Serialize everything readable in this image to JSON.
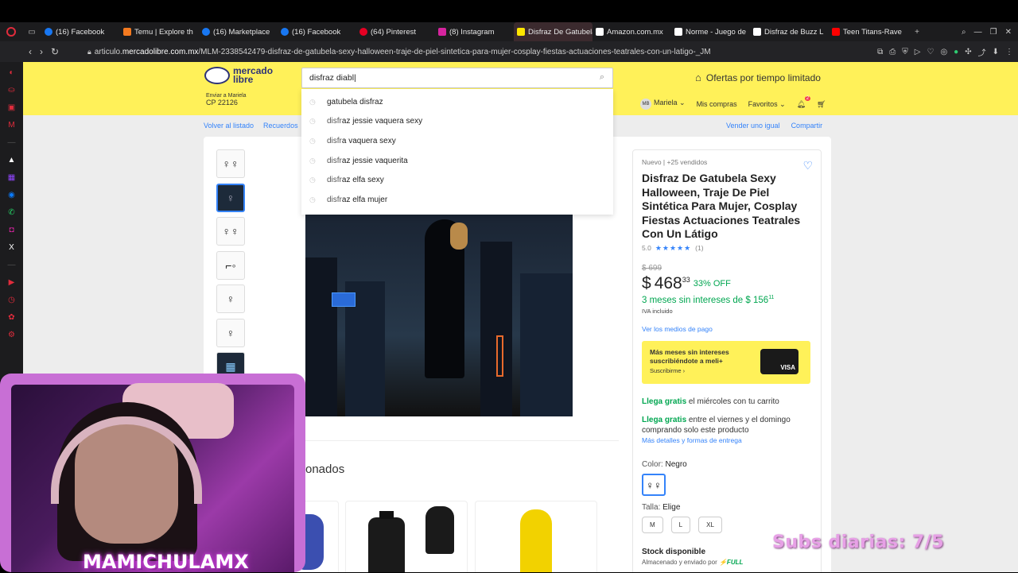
{
  "browser": {
    "tabs": [
      {
        "label": "(16) Facebook",
        "icon": "facebook-icon",
        "color": "#1877f2"
      },
      {
        "label": "Temu | Explore th",
        "icon": "temu-icon",
        "color": "#f47a20"
      },
      {
        "label": "(16) Marketplace",
        "icon": "facebook-icon",
        "color": "#1877f2"
      },
      {
        "label": "(16) Facebook",
        "icon": "facebook-icon",
        "color": "#1877f2"
      },
      {
        "label": "(64) Pinterest",
        "icon": "pinterest-icon",
        "color": "#e60023"
      },
      {
        "label": "(8) Instagram",
        "icon": "instagram-icon",
        "color": "#d6249f"
      },
      {
        "label": "Disfraz De Gatubela Sexy",
        "icon": "mercadolibre-icon",
        "color": "#ffe600",
        "active": true
      },
      {
        "label": "Amazon.com.mx",
        "icon": "amazon-icon",
        "color": "#ffffff"
      },
      {
        "label": "Norme - Juego de",
        "icon": "generic-icon",
        "color": "#ffffff"
      },
      {
        "label": "Disfraz de Buzz L",
        "icon": "generic-icon",
        "color": "#ffffff"
      },
      {
        "label": "Teen Titans-Rave",
        "icon": "youtube-icon",
        "color": "#ff0000"
      }
    ],
    "url_prefix": "articulo.",
    "url_domain": "mercadolibre.com.mx",
    "url_path": "/MLM-2338542479-disfraz-de-gatubela-sexy-halloween-traje-de-piel-sintetica-para-mujer-cosplay-fiestas-actuaciones-teatrales-con-un-latigo-_JM"
  },
  "header": {
    "logo_line1": "mercado",
    "logo_line2": "libre",
    "location_line1": "Enviar a Mariela",
    "location_line2": "CP 22126",
    "search_value": "disfraz diabl",
    "promo": "Ofertas por tiempo limitado",
    "user_initials": "MB",
    "user_name": "Mariela",
    "purchases": "Mis compras",
    "favorites": "Favoritos",
    "notif_count": "2"
  },
  "suggestions": [
    {
      "prefix": "",
      "bold": "gatubela disfraz"
    },
    {
      "prefix": "disfr",
      "bold": "az jessie vaquera sexy"
    },
    {
      "prefix": "disfr",
      "bold": "a vaquera sexy"
    },
    {
      "prefix": "disfr",
      "bold": "az jessie vaquerita"
    },
    {
      "prefix": "disfr",
      "bold": "az elfa sexy"
    },
    {
      "prefix": "disfr",
      "bold": "az elfa mujer"
    }
  ],
  "breadcrumbs": {
    "back": "Volver al listado",
    "recent": "Recuerdos",
    "sell_similar": "Vender uno igual",
    "share": "Compartir"
  },
  "product": {
    "condition": "Nuevo  |  +25 vendidos",
    "title": "Disfraz De Gatubela Sexy Halloween, Traje De Piel Sintética Para Mujer, Cosplay Fiestas Actuaciones Teatrales Con Un Látigo",
    "rating_value": "5.0",
    "stars": "★★★★★",
    "rating_count": "(1)",
    "old_price": "$ 699",
    "currency": "$",
    "price": "468",
    "cents": "33",
    "discount": "33% OFF",
    "installments": "3 meses sin intereses de $ 156",
    "installments_cents": "11",
    "iva": "IVA incluido",
    "payment_link": "Ver los medios de pago",
    "banner_title": "Más meses sin intereses suscribiéndote a meli+",
    "banner_cta": "Suscribirme ›",
    "banner_card": "VISA",
    "ship1_bold": "Llega gratis",
    "ship1_rest": "el miércoles con tu carrito",
    "ship2_bold": "Llega gratis",
    "ship2_rest": "entre el viernes y el domingo comprando solo este producto",
    "ship_link": "Más detalles y formas de entrega",
    "color_label": "Color:",
    "color_value": "Negro",
    "size_label": "Talla:",
    "size_value": "Elige",
    "sizes": [
      "M",
      "L",
      "XL"
    ],
    "stock": "Stock disponible",
    "stock_sub": "Almacenado y enviado por",
    "stock_full": "⚡FULL"
  },
  "related_title": "onados",
  "overlay": {
    "streamer_name": "MAMICHULAMX",
    "subs": "Subs diarias: 7/5"
  },
  "colors": {
    "ml_yellow": "#fff159",
    "ml_blue": "#3483fa",
    "ml_green": "#00a650",
    "cam_border": "#c86fd5"
  }
}
